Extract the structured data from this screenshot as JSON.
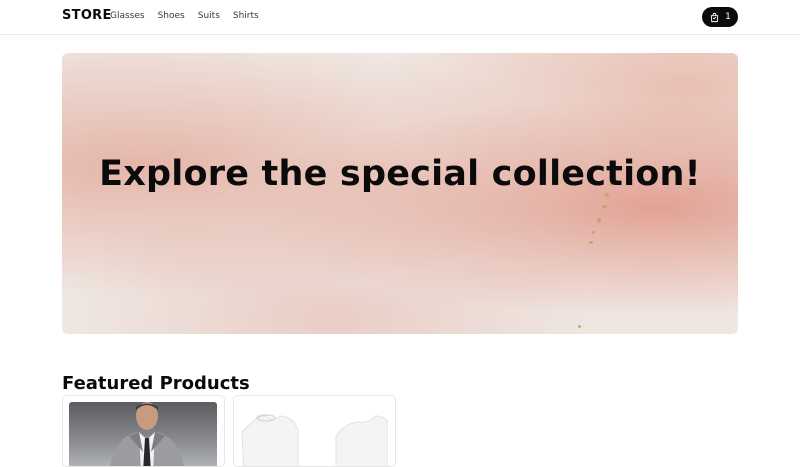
{
  "header": {
    "brand": "STORE",
    "nav": [
      "Glasses",
      "Shoes",
      "Suits",
      "Shirts"
    ],
    "cart_count": "1",
    "cart_icon": "shopping-bag-icon"
  },
  "hero": {
    "title": "Explore the special collection!"
  },
  "featured": {
    "title": "Featured Products",
    "products": [
      {
        "image": "man-in-grey-suit"
      },
      {
        "image": "white-t-shirts"
      }
    ]
  },
  "colors": {
    "accent": "#0b0b0b",
    "hero_pink": "#e0a08f",
    "hero_cream": "#efe6e1"
  }
}
